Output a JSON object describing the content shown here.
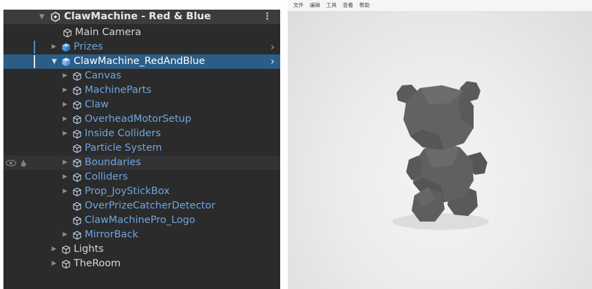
{
  "hierarchy": {
    "scene_name": "ClawMachine - Red & Blue",
    "items": [
      {
        "label": "Main Camera",
        "color": "white"
      },
      {
        "label": "Prizes",
        "color": "blue"
      },
      {
        "label": "ClawMachine_RedAndBlue",
        "color": "white"
      },
      {
        "label": "Canvas",
        "color": "blue"
      },
      {
        "label": "MachineParts",
        "color": "blue"
      },
      {
        "label": "Claw",
        "color": "blue"
      },
      {
        "label": "OverheadMotorSetup",
        "color": "blue"
      },
      {
        "label": "Inside Colliders",
        "color": "blue"
      },
      {
        "label": "Particle System",
        "color": "blue"
      },
      {
        "label": "Boundaries",
        "color": "blue"
      },
      {
        "label": "Colliders",
        "color": "blue"
      },
      {
        "label": "Prop_JoyStickBox",
        "color": "blue"
      },
      {
        "label": "OverPrizeCatcherDetector",
        "color": "blue"
      },
      {
        "label": "ClawMachinePro_Logo",
        "color": "blue"
      },
      {
        "label": "MirrorBack",
        "color": "blue"
      },
      {
        "label": "Lights",
        "color": "white"
      },
      {
        "label": "TheRoom",
        "color": "white"
      }
    ]
  },
  "viewer": {
    "menu": [
      "文件",
      "编辑",
      "工具",
      "查看",
      "帮助"
    ]
  },
  "colors": {
    "panel_bg": "#2b2b2b",
    "selection": "#2c5d87",
    "prefab_text": "#6ea6e2",
    "bear": "#5c5c5c"
  }
}
